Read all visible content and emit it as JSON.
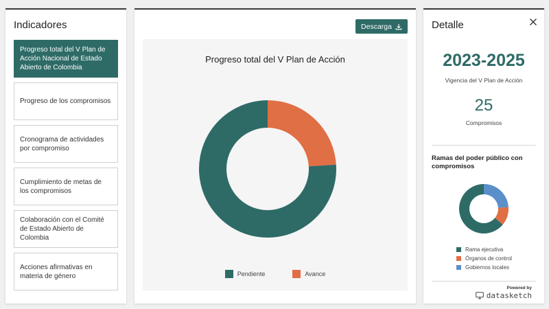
{
  "left_panel": {
    "title": "Indicadores",
    "items": [
      {
        "label": "Progreso total del V Plan de Acción Nacional de Estado Abierto de Colombia"
      },
      {
        "label": "Progreso de los compromisos"
      },
      {
        "label": "Cronograma de actividades por compromiso"
      },
      {
        "label": "Cumplimiento de metas de los compromisos"
      },
      {
        "label": "Colaboración con el Comité de Estado Abierto de Colombia"
      },
      {
        "label": "Acciones afirmativas en materia de género"
      }
    ]
  },
  "center_panel": {
    "download_label": "Descarga",
    "download_icon": "download-icon"
  },
  "chart_data": {
    "type": "pie",
    "donut": true,
    "title": "Progreso total del V Plan de Acción",
    "categories": [
      "Avance",
      "Pendiente"
    ],
    "values": [
      24,
      76
    ],
    "colors": [
      "#e06f45",
      "#2e6b67"
    ],
    "legend": [
      {
        "name": "Pendiente",
        "color": "#2e6b67"
      },
      {
        "name": "Avance",
        "color": "#e06f45"
      }
    ],
    "legend_position": "bottom"
  },
  "right_panel": {
    "title": "Detalle",
    "close_icon": "close-icon",
    "period": "2023-2025",
    "period_label": "Vigencia del V Plan de Acción",
    "count": "25",
    "count_label": "Compromisos",
    "branches_title": "Ramas del poder público con compromisos",
    "branches_chart": {
      "type": "pie",
      "donut": true,
      "categories": [
        "Gobiernos locales",
        "Órganos de control",
        "Rama ejecutiva"
      ],
      "values": [
        24,
        12,
        64
      ],
      "colors": [
        "#5b8fc9",
        "#e06f45",
        "#2e6b67"
      ],
      "legend": [
        {
          "name": "Rama ejecutiva",
          "color": "#2e6b67"
        },
        {
          "name": "Órganos de control",
          "color": "#e06f45"
        },
        {
          "name": "Gobiernos locales",
          "color": "#5b8fc9"
        }
      ]
    },
    "powered_by": "Powered by",
    "brand": "datasketch"
  }
}
